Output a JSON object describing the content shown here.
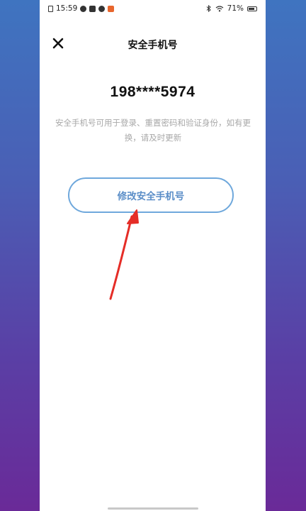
{
  "status_bar": {
    "time": "15:59",
    "battery": "71%"
  },
  "header": {
    "title": "安全手机号"
  },
  "main": {
    "phone_number": "198****5974",
    "description": "安全手机号可用于登录、重置密码和验证身份，如有更换，请及时更新",
    "change_button_label": "修改安全手机号"
  },
  "colors": {
    "accent": "#5b8ec8",
    "annotation_arrow": "#e52d27"
  },
  "icons": {
    "close": "close-icon",
    "annotation": "red-arrow-annotation"
  }
}
